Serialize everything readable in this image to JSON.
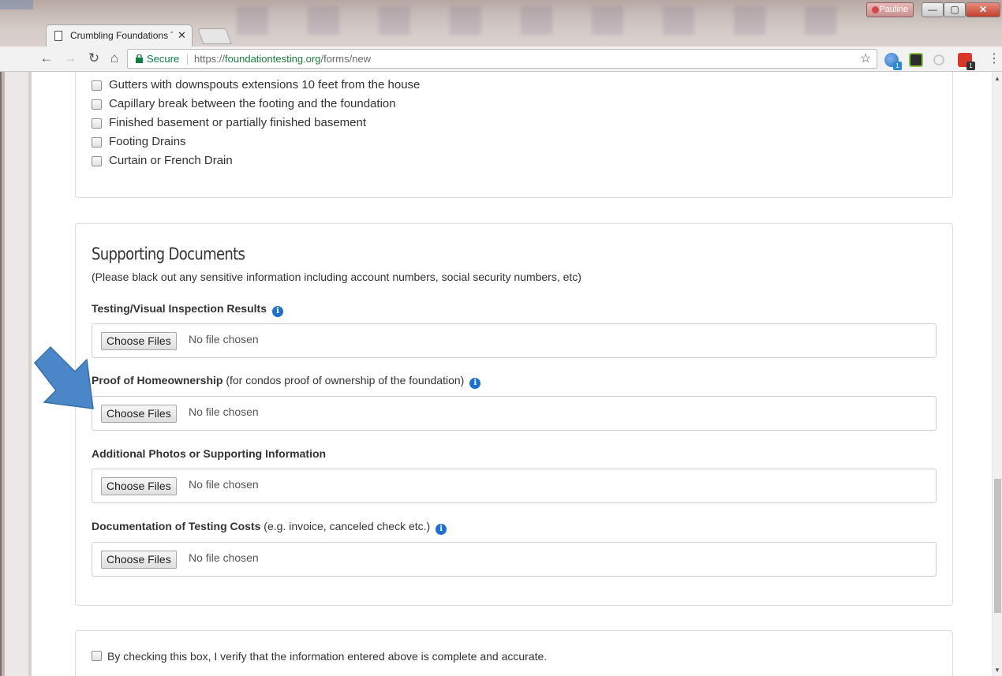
{
  "browser": {
    "tab_title": "Crumbling Foundations T",
    "tab_close": "✕",
    "secure_label": "Secure",
    "url_scheme": "https://",
    "url_host": "foundationtesting.org",
    "url_path": "/forms/new",
    "profile_name": "Pauline",
    "ext_badge_1": "1",
    "ext_badge_2": "1",
    "window_min": "—",
    "window_max": "▢",
    "window_close": "✕"
  },
  "foundation_features": {
    "options": [
      "Gutters with downspouts extensions 10 feet from the house",
      "Capillary break between the footing and the foundation",
      "Finished basement or partially finished basement",
      "Footing Drains",
      "Curtain or French Drain"
    ]
  },
  "supporting_documents": {
    "title": "Supporting Documents",
    "note": "(Please black out any sensitive information including account numbers, social security numbers, etc)",
    "fields": [
      {
        "label_bold": "Testing/Visual Inspection Results",
        "label_rest": "",
        "button": "Choose Files",
        "status": "No file chosen"
      },
      {
        "label_bold": "Proof of Homeownership",
        "label_rest": " (for condos proof of ownership of the foundation)",
        "button": "Choose Files",
        "status": "No file chosen"
      },
      {
        "label_bold": "Additional Photos or Supporting Information",
        "label_rest": "",
        "button": "Choose Files",
        "status": "No file chosen"
      },
      {
        "label_bold": "Documentation of Testing Costs",
        "label_rest": " (e.g. invoice, canceled check etc.)",
        "button": "Choose Files",
        "status": "No file chosen"
      }
    ],
    "info_glyph": "i"
  },
  "verification": {
    "label": "By checking this box, I verify that the information entered above is complete and accurate."
  },
  "icons": [
    "page-icon",
    "back-arrow-icon",
    "forward-arrow-icon",
    "reload-icon",
    "home-icon",
    "lock-icon",
    "star-icon",
    "info-icon",
    "menu-icon",
    "annotation-arrow"
  ],
  "colors": {
    "secure_green": "#0b8043",
    "info_blue": "#1f6fd1",
    "arrow_blue": "#4a86c8"
  }
}
